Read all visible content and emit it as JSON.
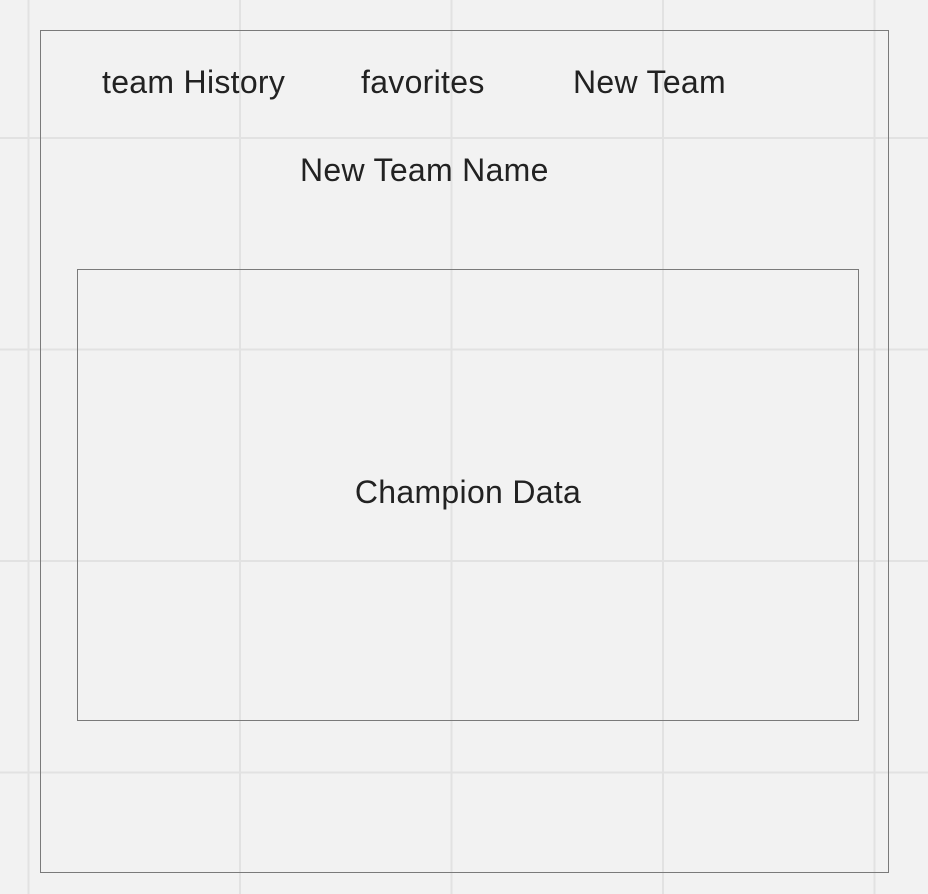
{
  "nav": {
    "items": [
      {
        "label": "team History"
      },
      {
        "label": "favorites"
      },
      {
        "label": "New Team"
      }
    ]
  },
  "team": {
    "name_label": "New Team Name"
  },
  "data_panel": {
    "label": "Champion Data"
  }
}
